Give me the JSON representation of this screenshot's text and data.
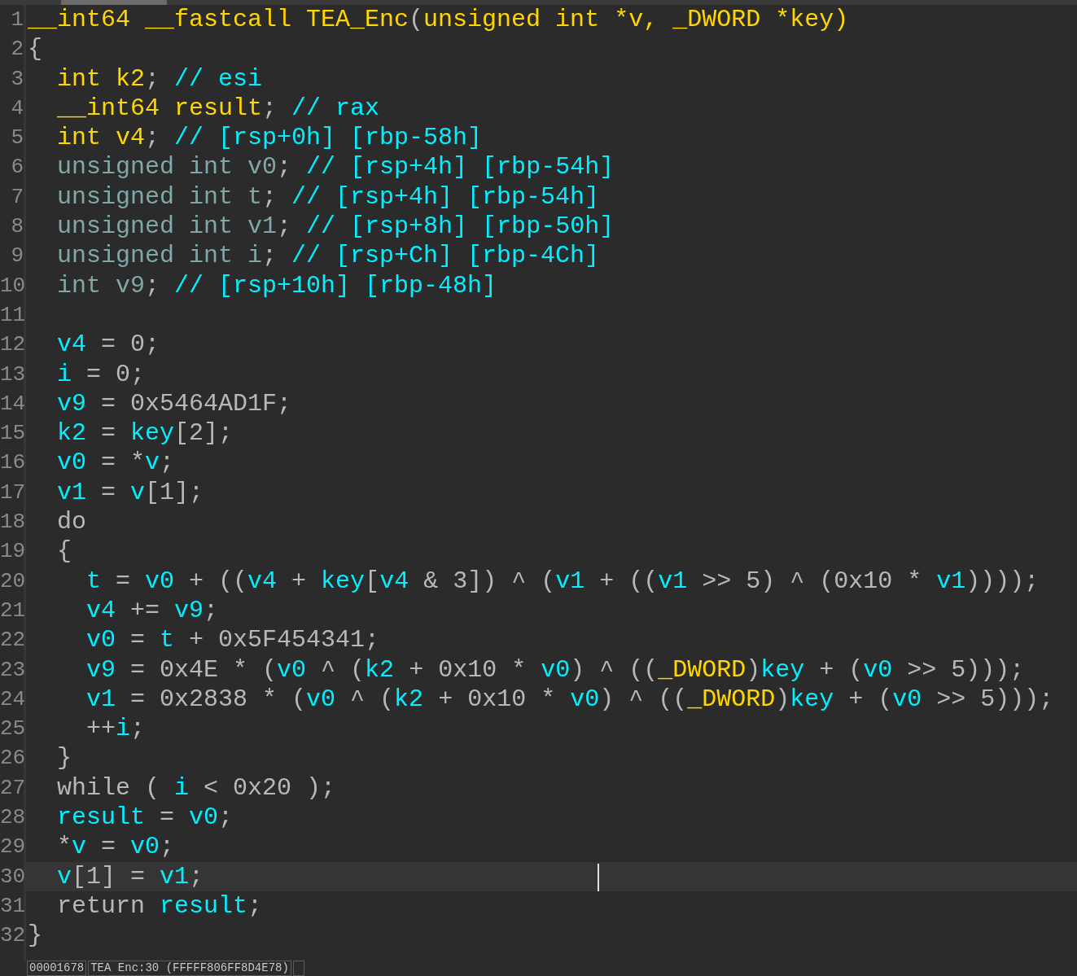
{
  "editor": {
    "lines": [
      {
        "number": "1",
        "current": false,
        "tokens": [
          {
            "kind": "kw",
            "text": "__int64 __fastcall TEA_Enc"
          },
          {
            "kind": "plain",
            "text": "("
          },
          {
            "kind": "kw",
            "text": "unsigned int *v, _DWORD *key)"
          }
        ]
      },
      {
        "number": "2",
        "current": false,
        "tokens": [
          {
            "kind": "plain",
            "text": "{"
          }
        ]
      },
      {
        "number": "3",
        "current": false,
        "tokens": [
          {
            "kind": "kw",
            "text": "  int k2"
          },
          {
            "kind": "plain",
            "text": ";"
          },
          {
            "kind": "var",
            "text": " // esi"
          }
        ]
      },
      {
        "number": "4",
        "current": false,
        "tokens": [
          {
            "kind": "kw",
            "text": "  __int64 result"
          },
          {
            "kind": "plain",
            "text": ";"
          },
          {
            "kind": "var",
            "text": " // rax"
          }
        ]
      },
      {
        "number": "5",
        "current": false,
        "tokens": [
          {
            "kind": "kw",
            "text": "  int v4"
          },
          {
            "kind": "plain",
            "text": ";"
          },
          {
            "kind": "var",
            "text": " // [rsp+0h] [rbp-58h]"
          }
        ]
      },
      {
        "number": "6",
        "current": false,
        "tokens": [
          {
            "kind": "type",
            "text": "  unsigned int v0"
          },
          {
            "kind": "plain",
            "text": ";"
          },
          {
            "kind": "var",
            "text": " // [rsp+4h] [rbp-54h]"
          }
        ]
      },
      {
        "number": "7",
        "current": false,
        "tokens": [
          {
            "kind": "type",
            "text": "  unsigned int t"
          },
          {
            "kind": "plain",
            "text": ";"
          },
          {
            "kind": "var",
            "text": " // [rsp+4h] [rbp-54h]"
          }
        ]
      },
      {
        "number": "8",
        "current": false,
        "tokens": [
          {
            "kind": "type",
            "text": "  unsigned int v1"
          },
          {
            "kind": "plain",
            "text": ";"
          },
          {
            "kind": "var",
            "text": " // [rsp+8h] [rbp-50h]"
          }
        ]
      },
      {
        "number": "9",
        "current": false,
        "tokens": [
          {
            "kind": "type",
            "text": "  unsigned int i"
          },
          {
            "kind": "plain",
            "text": ";"
          },
          {
            "kind": "var",
            "text": " // [rsp+Ch] [rbp-4Ch]"
          }
        ]
      },
      {
        "number": "10",
        "current": false,
        "tokens": [
          {
            "kind": "type",
            "text": "  int v9"
          },
          {
            "kind": "plain",
            "text": ";"
          },
          {
            "kind": "var",
            "text": " // [rsp+10h] [rbp-48h]"
          }
        ]
      },
      {
        "number": "11",
        "current": false
      },
      {
        "number": "12",
        "current": false,
        "tokens": [
          {
            "kind": "var",
            "text": "  v4"
          },
          {
            "kind": "plain",
            "text": " = 0;"
          }
        ]
      },
      {
        "number": "13",
        "current": false,
        "tokens": [
          {
            "kind": "var",
            "text": "  i"
          },
          {
            "kind": "plain",
            "text": " = 0;"
          }
        ]
      },
      {
        "number": "14",
        "current": false,
        "tokens": [
          {
            "kind": "var",
            "text": "  v9"
          },
          {
            "kind": "plain",
            "text": " = 0x5464AD1F;"
          }
        ]
      },
      {
        "number": "15",
        "current": false,
        "tokens": [
          {
            "kind": "var",
            "text": "  k2"
          },
          {
            "kind": "plain",
            "text": " = "
          },
          {
            "kind": "var",
            "text": "key"
          },
          {
            "kind": "plain",
            "text": "[2];"
          }
        ]
      },
      {
        "number": "16",
        "current": false,
        "tokens": [
          {
            "kind": "var",
            "text": "  v0"
          },
          {
            "kind": "plain",
            "text": " = *"
          },
          {
            "kind": "var",
            "text": "v"
          },
          {
            "kind": "plain",
            "text": ";"
          }
        ]
      },
      {
        "number": "17",
        "current": false,
        "tokens": [
          {
            "kind": "var",
            "text": "  v1"
          },
          {
            "kind": "plain",
            "text": " = "
          },
          {
            "kind": "var",
            "text": "v"
          },
          {
            "kind": "plain",
            "text": "[1];"
          }
        ]
      },
      {
        "number": "18",
        "current": false,
        "tokens": [
          {
            "kind": "plain",
            "text": "  do"
          }
        ]
      },
      {
        "number": "19",
        "current": false,
        "tokens": [
          {
            "kind": "plain",
            "text": "  {"
          }
        ]
      },
      {
        "number": "20",
        "current": false,
        "tokens": [
          {
            "kind": "var",
            "text": "    t"
          },
          {
            "kind": "plain",
            "text": " = "
          },
          {
            "kind": "var",
            "text": "v0"
          },
          {
            "kind": "plain",
            "text": " + (("
          },
          {
            "kind": "var",
            "text": "v4"
          },
          {
            "kind": "plain",
            "text": " + "
          },
          {
            "kind": "var",
            "text": "key"
          },
          {
            "kind": "plain",
            "text": "["
          },
          {
            "kind": "var",
            "text": "v4"
          },
          {
            "kind": "plain",
            "text": " & 3]) ^ ("
          },
          {
            "kind": "var",
            "text": "v1"
          },
          {
            "kind": "plain",
            "text": " + (("
          },
          {
            "kind": "var",
            "text": "v1"
          },
          {
            "kind": "plain",
            "text": " >> 5) ^ (0x10 * "
          },
          {
            "kind": "var",
            "text": "v1"
          },
          {
            "kind": "plain",
            "text": "))));"
          }
        ]
      },
      {
        "number": "21",
        "current": false,
        "tokens": [
          {
            "kind": "var",
            "text": "    v4"
          },
          {
            "kind": "plain",
            "text": " += "
          },
          {
            "kind": "var",
            "text": "v9"
          },
          {
            "kind": "plain",
            "text": ";"
          }
        ]
      },
      {
        "number": "22",
        "current": false,
        "tokens": [
          {
            "kind": "var",
            "text": "    v0"
          },
          {
            "kind": "plain",
            "text": " = "
          },
          {
            "kind": "var",
            "text": "t"
          },
          {
            "kind": "plain",
            "text": " + 0x5F454341;"
          }
        ]
      },
      {
        "number": "23",
        "current": false,
        "tokens": [
          {
            "kind": "var",
            "text": "    v9"
          },
          {
            "kind": "plain",
            "text": " = 0x4E * ("
          },
          {
            "kind": "var",
            "text": "v0"
          },
          {
            "kind": "plain",
            "text": " ^ ("
          },
          {
            "kind": "var",
            "text": "k2"
          },
          {
            "kind": "plain",
            "text": " + 0x10 * "
          },
          {
            "kind": "var",
            "text": "v0"
          },
          {
            "kind": "plain",
            "text": ") ^ (("
          },
          {
            "kind": "kw",
            "text": "_DWORD"
          },
          {
            "kind": "plain",
            "text": ")"
          },
          {
            "kind": "var",
            "text": "key"
          },
          {
            "kind": "plain",
            "text": " + ("
          },
          {
            "kind": "var",
            "text": "v0"
          },
          {
            "kind": "plain",
            "text": " >> 5)));"
          }
        ]
      },
      {
        "number": "24",
        "current": false,
        "tokens": [
          {
            "kind": "var",
            "text": "    v1"
          },
          {
            "kind": "plain",
            "text": " = 0x2838 * ("
          },
          {
            "kind": "var",
            "text": "v0"
          },
          {
            "kind": "plain",
            "text": " ^ ("
          },
          {
            "kind": "var",
            "text": "k2"
          },
          {
            "kind": "plain",
            "text": " + 0x10 * "
          },
          {
            "kind": "var",
            "text": "v0"
          },
          {
            "kind": "plain",
            "text": ") ^ (("
          },
          {
            "kind": "kw",
            "text": "_DWORD"
          },
          {
            "kind": "plain",
            "text": ")"
          },
          {
            "kind": "var",
            "text": "key"
          },
          {
            "kind": "plain",
            "text": " + ("
          },
          {
            "kind": "var",
            "text": "v0"
          },
          {
            "kind": "plain",
            "text": " >> 5)));"
          }
        ]
      },
      {
        "number": "25",
        "current": false,
        "tokens": [
          {
            "kind": "plain",
            "text": "    ++"
          },
          {
            "kind": "var",
            "text": "i"
          },
          {
            "kind": "plain",
            "text": ";"
          }
        ]
      },
      {
        "number": "26",
        "current": false,
        "tokens": [
          {
            "kind": "plain",
            "text": "  }"
          }
        ]
      },
      {
        "number": "27",
        "current": false,
        "tokens": [
          {
            "kind": "plain",
            "text": "  while ( "
          },
          {
            "kind": "var",
            "text": "i"
          },
          {
            "kind": "plain",
            "text": " < 0x20 );"
          }
        ]
      },
      {
        "number": "28",
        "current": false,
        "tokens": [
          {
            "kind": "var",
            "text": "  result"
          },
          {
            "kind": "plain",
            "text": " = "
          },
          {
            "kind": "var",
            "text": "v0"
          },
          {
            "kind": "plain",
            "text": ";"
          }
        ]
      },
      {
        "number": "29",
        "current": false,
        "tokens": [
          {
            "kind": "plain",
            "text": "  *"
          },
          {
            "kind": "var",
            "text": "v"
          },
          {
            "kind": "plain",
            "text": " = "
          },
          {
            "kind": "var",
            "text": "v0"
          },
          {
            "kind": "plain",
            "text": ";"
          }
        ]
      },
      {
        "number": "30",
        "current": true,
        "tokens": [
          {
            "kind": "var",
            "text": "  v"
          },
          {
            "kind": "plain",
            "text": "[1] = "
          },
          {
            "kind": "var",
            "text": "v1"
          },
          {
            "kind": "plain",
            "text": ";"
          }
        ]
      },
      {
        "number": "31",
        "current": false,
        "tokens": [
          {
            "kind": "plain",
            "text": "  return "
          },
          {
            "kind": "var",
            "text": "result"
          },
          {
            "kind": "plain",
            "text": ";"
          }
        ]
      },
      {
        "number": "32",
        "current": false,
        "tokens": [
          {
            "kind": "plain",
            "text": "}"
          }
        ]
      }
    ]
  },
  "status_bar": {
    "fields": [
      "00001678",
      "TEA Enc:30 (FFFFF806FF8D4E78)"
    ]
  }
}
